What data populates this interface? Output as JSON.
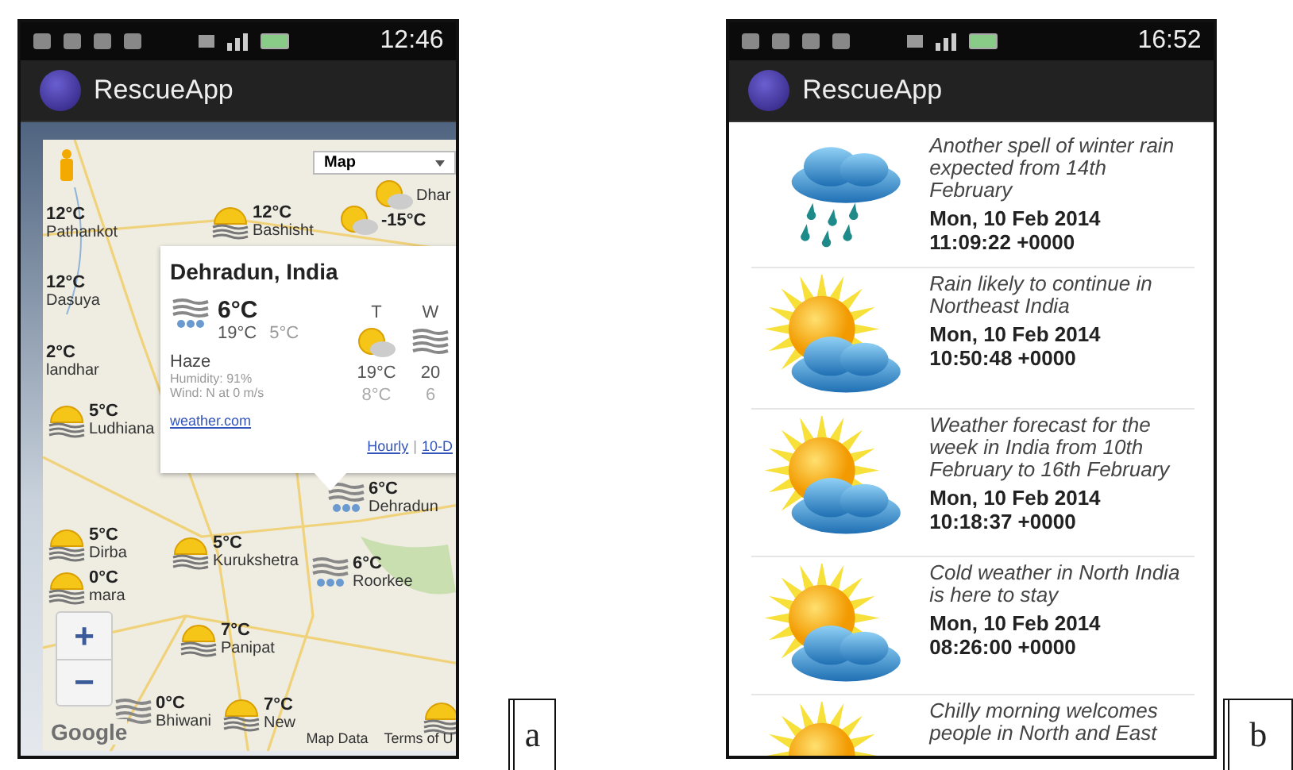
{
  "map_screen": {
    "figure_label": "a",
    "status_bar": {
      "time": "12:46"
    },
    "app_bar": {
      "title": "RescueApp"
    },
    "map_type": "Map",
    "markers": [
      {
        "temp": "12°C",
        "place": "Pathankot",
        "kind": "none"
      },
      {
        "temp": "12°C",
        "place": "Bashisht",
        "kind": "sun"
      },
      {
        "temp": "-15°C",
        "kind": "partly"
      },
      {
        "place": "Dhar",
        "kind": "partly"
      },
      {
        "temp": "12°C",
        "place": "Dasuya",
        "kind": "none"
      },
      {
        "temp": "2°C",
        "place": "landhar",
        "kind": "none"
      },
      {
        "temp": "5°C",
        "place": "Ludhiana",
        "kind": "sun"
      },
      {
        "temp": "6°C",
        "place": "Dehradun",
        "kind": "rainhaze"
      },
      {
        "temp": "5°C",
        "place": "Dirba",
        "kind": "sun"
      },
      {
        "temp": "5°C",
        "place": "Kurukshetra",
        "kind": "sun"
      },
      {
        "temp": "6°C",
        "place": "Roorkee",
        "kind": "rainhaze"
      },
      {
        "temp": "0°C",
        "place": "mara",
        "kind": "sun"
      },
      {
        "temp": "7°C",
        "place": "Panipat",
        "kind": "sun"
      },
      {
        "temp": "0°C",
        "place": "Bhiwani",
        "kind": "haze"
      },
      {
        "temp": "7°C",
        "place": "New",
        "kind": "sun"
      },
      {
        "kind": "sun"
      }
    ],
    "popup": {
      "title": "Dehradun, India",
      "kind": "rainhaze",
      "temp": "6°C",
      "high": "19°C",
      "low": "5°C",
      "condition": "Haze",
      "humidity": "Humidity: 91%",
      "wind": "Wind: N at 0 m/s",
      "source": "weather.com",
      "forecast": [
        {
          "day": "T",
          "kind": "partly",
          "high": "19°C",
          "low": "8°C"
        },
        {
          "day": "W",
          "kind": "haze",
          "high": "20",
          "low": "6"
        }
      ],
      "links": [
        "Hourly",
        "10-D"
      ],
      "link_separator": "|"
    },
    "zoom_controls": [
      "+",
      "−"
    ],
    "attribution": {
      "logo": "Google",
      "links": [
        "Map Data",
        "Terms of U"
      ]
    }
  },
  "news_screen": {
    "figure_label": "b",
    "status_bar": {
      "time": "16:52"
    },
    "app_bar": {
      "title": "RescueApp"
    },
    "items": [
      {
        "kind": "rain",
        "title": "Another spell of winter rain expected from 14th February",
        "date": "Mon, 10 Feb 2014 11:09:22 +0000"
      },
      {
        "kind": "partly",
        "title": "Rain likely to continue in Northeast India",
        "date": "Mon, 10 Feb 2014 10:50:48 +0000"
      },
      {
        "kind": "partly",
        "title": "Weather forecast for the week in India from 10th February to 16th February",
        "date": "Mon, 10 Feb 2014 10:18:37 +0000"
      },
      {
        "kind": "partly",
        "title": "Cold weather in North India is here to stay",
        "date": "Mon, 10 Feb 2014 08:26:00 +0000"
      },
      {
        "kind": "partly",
        "title": "Chilly morning welcomes people in North and East"
      }
    ]
  }
}
